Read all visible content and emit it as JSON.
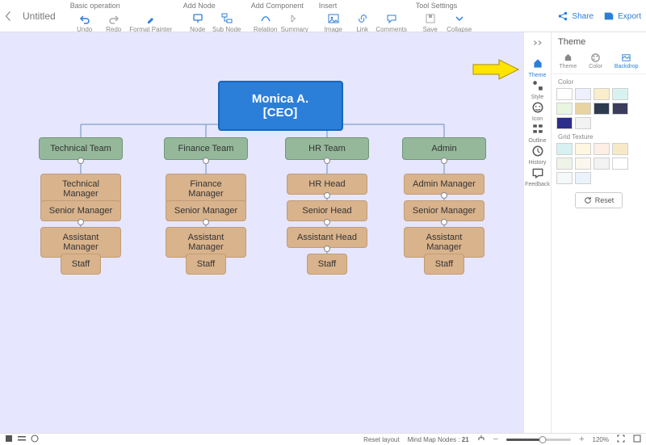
{
  "header": {
    "doc_title": "Untitled",
    "groups": [
      {
        "title": "Basic operation",
        "items": [
          {
            "name": "undo-button",
            "label": "Undo",
            "icon": "undo"
          },
          {
            "name": "redo-button",
            "label": "Redo",
            "icon": "redo",
            "gray": true
          },
          {
            "name": "format-painter-button",
            "label": "Format Painter",
            "icon": "brush",
            "wider": true
          }
        ]
      },
      {
        "title": "Add Node",
        "items": [
          {
            "name": "add-node-button",
            "label": "Node",
            "icon": "node"
          },
          {
            "name": "add-subnode-button",
            "label": "Sub Node",
            "icon": "subnode"
          }
        ]
      },
      {
        "title": "Add Component",
        "items": [
          {
            "name": "relation-button",
            "label": "Relation",
            "icon": "relation"
          },
          {
            "name": "summary-button",
            "label": "Summary",
            "icon": "summary",
            "gray": true
          }
        ]
      },
      {
        "title": "Insert",
        "items": [
          {
            "name": "insert-image-button",
            "label": "Image",
            "icon": "image"
          },
          {
            "name": "insert-link-button",
            "label": "Link",
            "icon": "link"
          },
          {
            "name": "insert-comments-button",
            "label": "Comments",
            "icon": "comment"
          }
        ]
      },
      {
        "title": "Tool Settings",
        "items": [
          {
            "name": "save-button",
            "label": "Save",
            "icon": "save",
            "gray": true
          },
          {
            "name": "collapse-button",
            "label": "Collapse",
            "icon": "collapse"
          }
        ]
      }
    ],
    "right": {
      "share": "Share",
      "export": "Export"
    }
  },
  "iconbar": [
    {
      "name": "theme",
      "label": "Theme",
      "active": true
    },
    {
      "name": "style",
      "label": "Style"
    },
    {
      "name": "icon",
      "label": "Icon"
    },
    {
      "name": "outline",
      "label": "Outline"
    },
    {
      "name": "history",
      "label": "History"
    },
    {
      "name": "feedback",
      "label": "Feedback"
    }
  ],
  "panel": {
    "title": "Theme",
    "tabs": [
      {
        "name": "theme-tab",
        "label": "Theme"
      },
      {
        "name": "color-tab",
        "label": "Color"
      },
      {
        "name": "backdrop-tab",
        "label": "Backdrop",
        "active": true
      }
    ],
    "color_label": "Color",
    "colors": [
      "#ffffff",
      "#eef0ff",
      "#f8eec9",
      "#d9f2ef",
      "#e8f5e0",
      "#e8d4a2",
      "#2e3b4e",
      "#3b3b5c",
      "#2d2e8b",
      "#f2f2f2"
    ],
    "grid_label": "Grid Texture",
    "grid": [
      "#d8f0f1",
      "#fff7e0",
      "#fdeee6",
      "#f7e9c8",
      "#eef5e8",
      "#fcf7ec",
      "#f2f2f2",
      "#ffffff",
      "#f4f9f9",
      "#eaf3fb"
    ],
    "reset": "Reset"
  },
  "chart_data": {
    "type": "org",
    "root": {
      "id": "ceo",
      "label": "Monica A. [CEO]",
      "children": [
        {
          "id": "tech",
          "label": "Technical Team",
          "children": [
            {
              "id": "t1",
              "label": "Technical Manager"
            },
            {
              "id": "t2",
              "label": "Senior Manager"
            },
            {
              "id": "t3",
              "label": "Assistant Manager"
            },
            {
              "id": "t4",
              "label": "Staff"
            }
          ]
        },
        {
          "id": "fin",
          "label": "Finance Team",
          "children": [
            {
              "id": "f1",
              "label": "Finance Manager"
            },
            {
              "id": "f2",
              "label": "Senior Manager"
            },
            {
              "id": "f3",
              "label": "Assistant Manager"
            },
            {
              "id": "f4",
              "label": "Staff"
            }
          ]
        },
        {
          "id": "hr",
          "label": "HR Team",
          "children": [
            {
              "id": "h1",
              "label": "HR Head"
            },
            {
              "id": "h2",
              "label": "Senior Head"
            },
            {
              "id": "h3",
              "label": "Assistant Head"
            },
            {
              "id": "h4",
              "label": "Staff"
            }
          ]
        },
        {
          "id": "adm",
          "label": "Admin",
          "children": [
            {
              "id": "a1",
              "label": "Admin Manager"
            },
            {
              "id": "a2",
              "label": "Senior Manager"
            },
            {
              "id": "a3",
              "label": "Assistant Manager"
            },
            {
              "id": "a4",
              "label": "Staff"
            }
          ]
        }
      ]
    }
  },
  "status": {
    "reset_layout": "Reset layout",
    "nodes_label": "Mind Map Nodes :",
    "nodes_count": "21",
    "zoom": "120%"
  }
}
